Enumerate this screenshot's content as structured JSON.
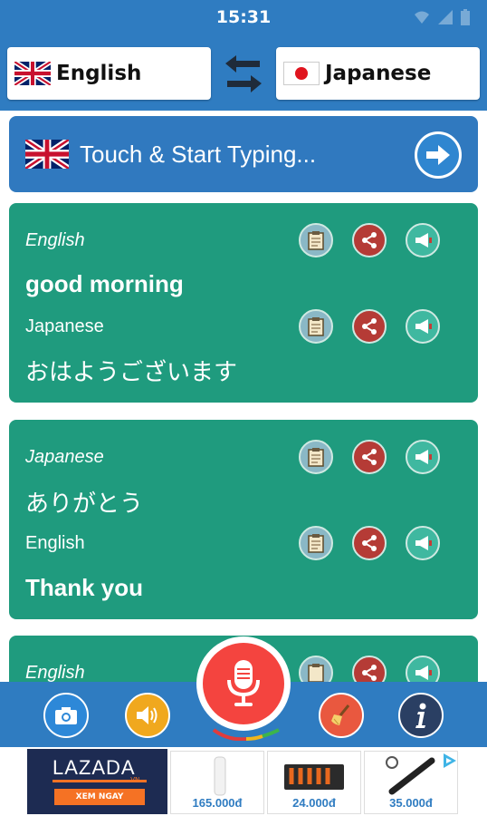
{
  "status": {
    "time": "15:31"
  },
  "languages": {
    "source": "English",
    "target": "Japanese"
  },
  "input": {
    "placeholder": "Touch & Start Typing..."
  },
  "translations": [
    {
      "from_label": "English",
      "from_text": "good morning",
      "to_label": "Japanese",
      "to_text": "おはようございます"
    },
    {
      "from_label": "Japanese",
      "from_text": "ありがとう",
      "to_label": "English",
      "to_text": "Thank you"
    },
    {
      "from_label": "English"
    }
  ],
  "ad": {
    "brand": "LAZADA",
    "brand_suffix": ".VN",
    "cta": "XEM NGAY",
    "prices": [
      "165.000đ",
      "24.000đ",
      "35.000đ"
    ]
  },
  "icons": {
    "swap": "swap-arrows-icon",
    "copy": "clipboard-icon",
    "share": "share-icon",
    "speak": "megaphone-icon",
    "camera": "camera-icon",
    "volume": "speaker-icon",
    "mic": "microphone-icon",
    "clear": "broom-icon",
    "info": "info-icon"
  },
  "colors": {
    "primary": "#2f7cc1",
    "card": "#1f9b7e",
    "mic": "#f4443f",
    "share": "#b53b36"
  }
}
